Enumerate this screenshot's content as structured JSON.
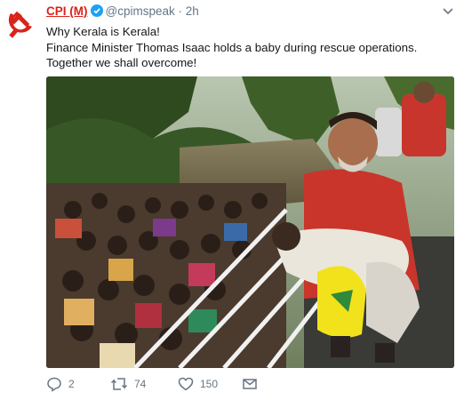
{
  "tweet": {
    "author_name": "CPI (M)",
    "handle": "@cpimspeak",
    "separator": "·",
    "time": "2h",
    "lines": [
      "Why Kerala is Kerala!",
      "Finance Minister Thomas Isaac holds a baby during rescue operations.",
      "Together we shall overcome!"
    ]
  },
  "actions": {
    "reply_count": "2",
    "retweet_count": "74",
    "like_count": "150"
  },
  "colors": {
    "brand_red": "#d9241b",
    "verified_blue": "#1da1f2",
    "muted": "#657786"
  },
  "icons": [
    "hammer-sickle-icon",
    "verified-badge-icon",
    "chevron-down-icon",
    "reply-icon",
    "retweet-icon",
    "like-icon",
    "direct-message-icon"
  ]
}
